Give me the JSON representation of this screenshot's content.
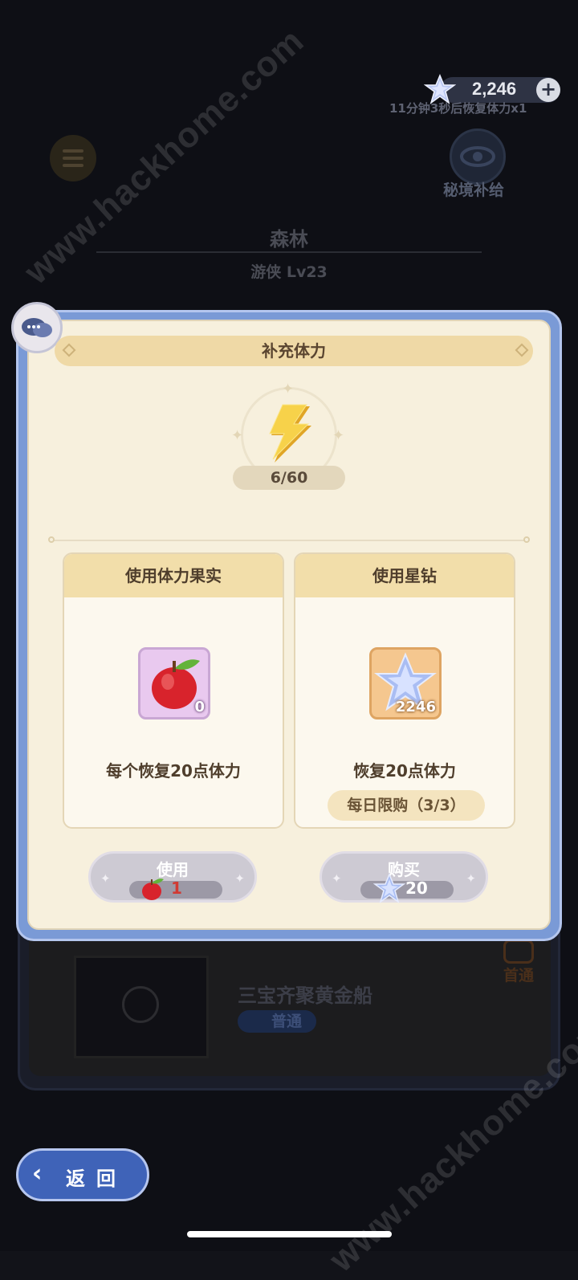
{
  "watermarks": [
    "www.hackhome.com",
    "www.hackhome.com"
  ],
  "topbar": {
    "gem_count": "2,246",
    "plus_symbol": "+",
    "recover_tip": "11分钟3秒后恢复体力x1"
  },
  "side": {
    "secret_supply_label": "秘境补给"
  },
  "stage": {
    "name": "森林",
    "subtitle": "游侠 Lv23"
  },
  "dialog": {
    "title": "补充体力",
    "energy": "6/60",
    "left_option": {
      "header": "使用体力果实",
      "item_count": "0",
      "description": "每个恢复20点体力",
      "button_label": "使用",
      "cost": "1"
    },
    "right_option": {
      "header": "使用星钻",
      "item_count": "2246",
      "description": "恢复20点体力",
      "limit": "每日限购（3/3）",
      "button_label": "购买",
      "cost": "20"
    }
  },
  "lower_card": {
    "title": "三宝齐聚黄金船",
    "badge": "普通",
    "first_clear": "首通"
  },
  "back": {
    "arrow": "‹",
    "label": "返回"
  },
  "colors": {
    "frame_blue": "#7a9ad6",
    "parchment": "#f7f0dd",
    "header_gold": "#f2deaa",
    "apple_cost_red": "#d13a33",
    "gem_cost_white": "#ffffff"
  }
}
